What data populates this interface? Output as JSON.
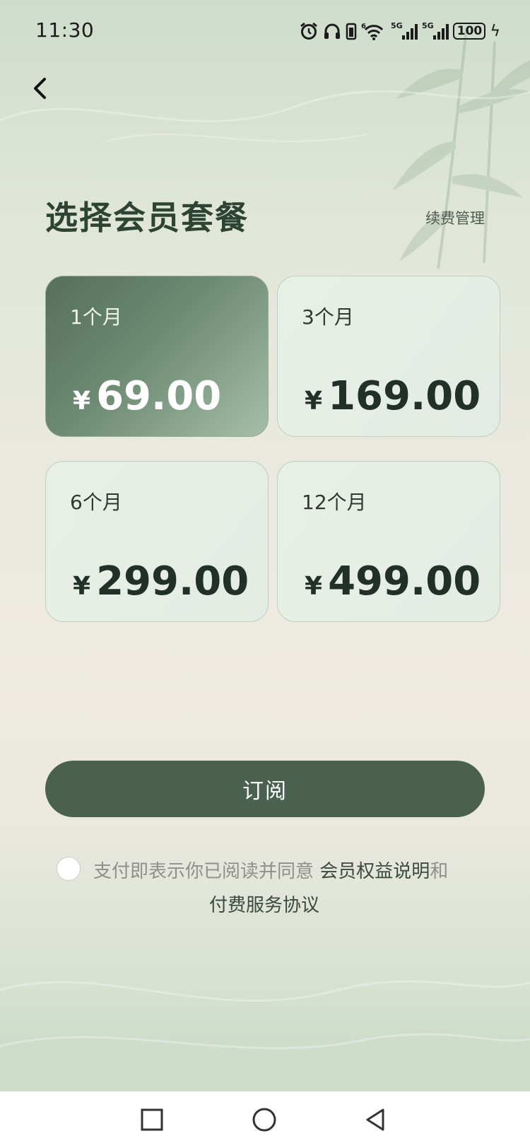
{
  "status_bar": {
    "time": "11:30",
    "battery": "100",
    "signal_label_1": "5G",
    "signal_label_2": "5G",
    "wifi_label": "6"
  },
  "header": {
    "title": "选择会员套餐",
    "renew_label": "续费管理"
  },
  "plans": [
    {
      "duration": "1个月",
      "currency": "¥",
      "price": "69.00",
      "selected": true
    },
    {
      "duration": "3个月",
      "currency": "¥",
      "price": "169.00",
      "selected": false
    },
    {
      "duration": "6个月",
      "currency": "¥",
      "price": "299.00",
      "selected": false
    },
    {
      "duration": "12个月",
      "currency": "¥",
      "price": "499.00",
      "selected": false
    }
  ],
  "subscribe_label": "订阅",
  "agreement": {
    "prefix": "支付即表示你已阅读并同意",
    "benefits_link": "会员权益说明",
    "conjunction": "和",
    "service_link": "付费服务协议",
    "checked": false
  },
  "colors": {
    "accent": "#4a6150",
    "title": "#2d4334",
    "selected_card": "#55705b"
  }
}
